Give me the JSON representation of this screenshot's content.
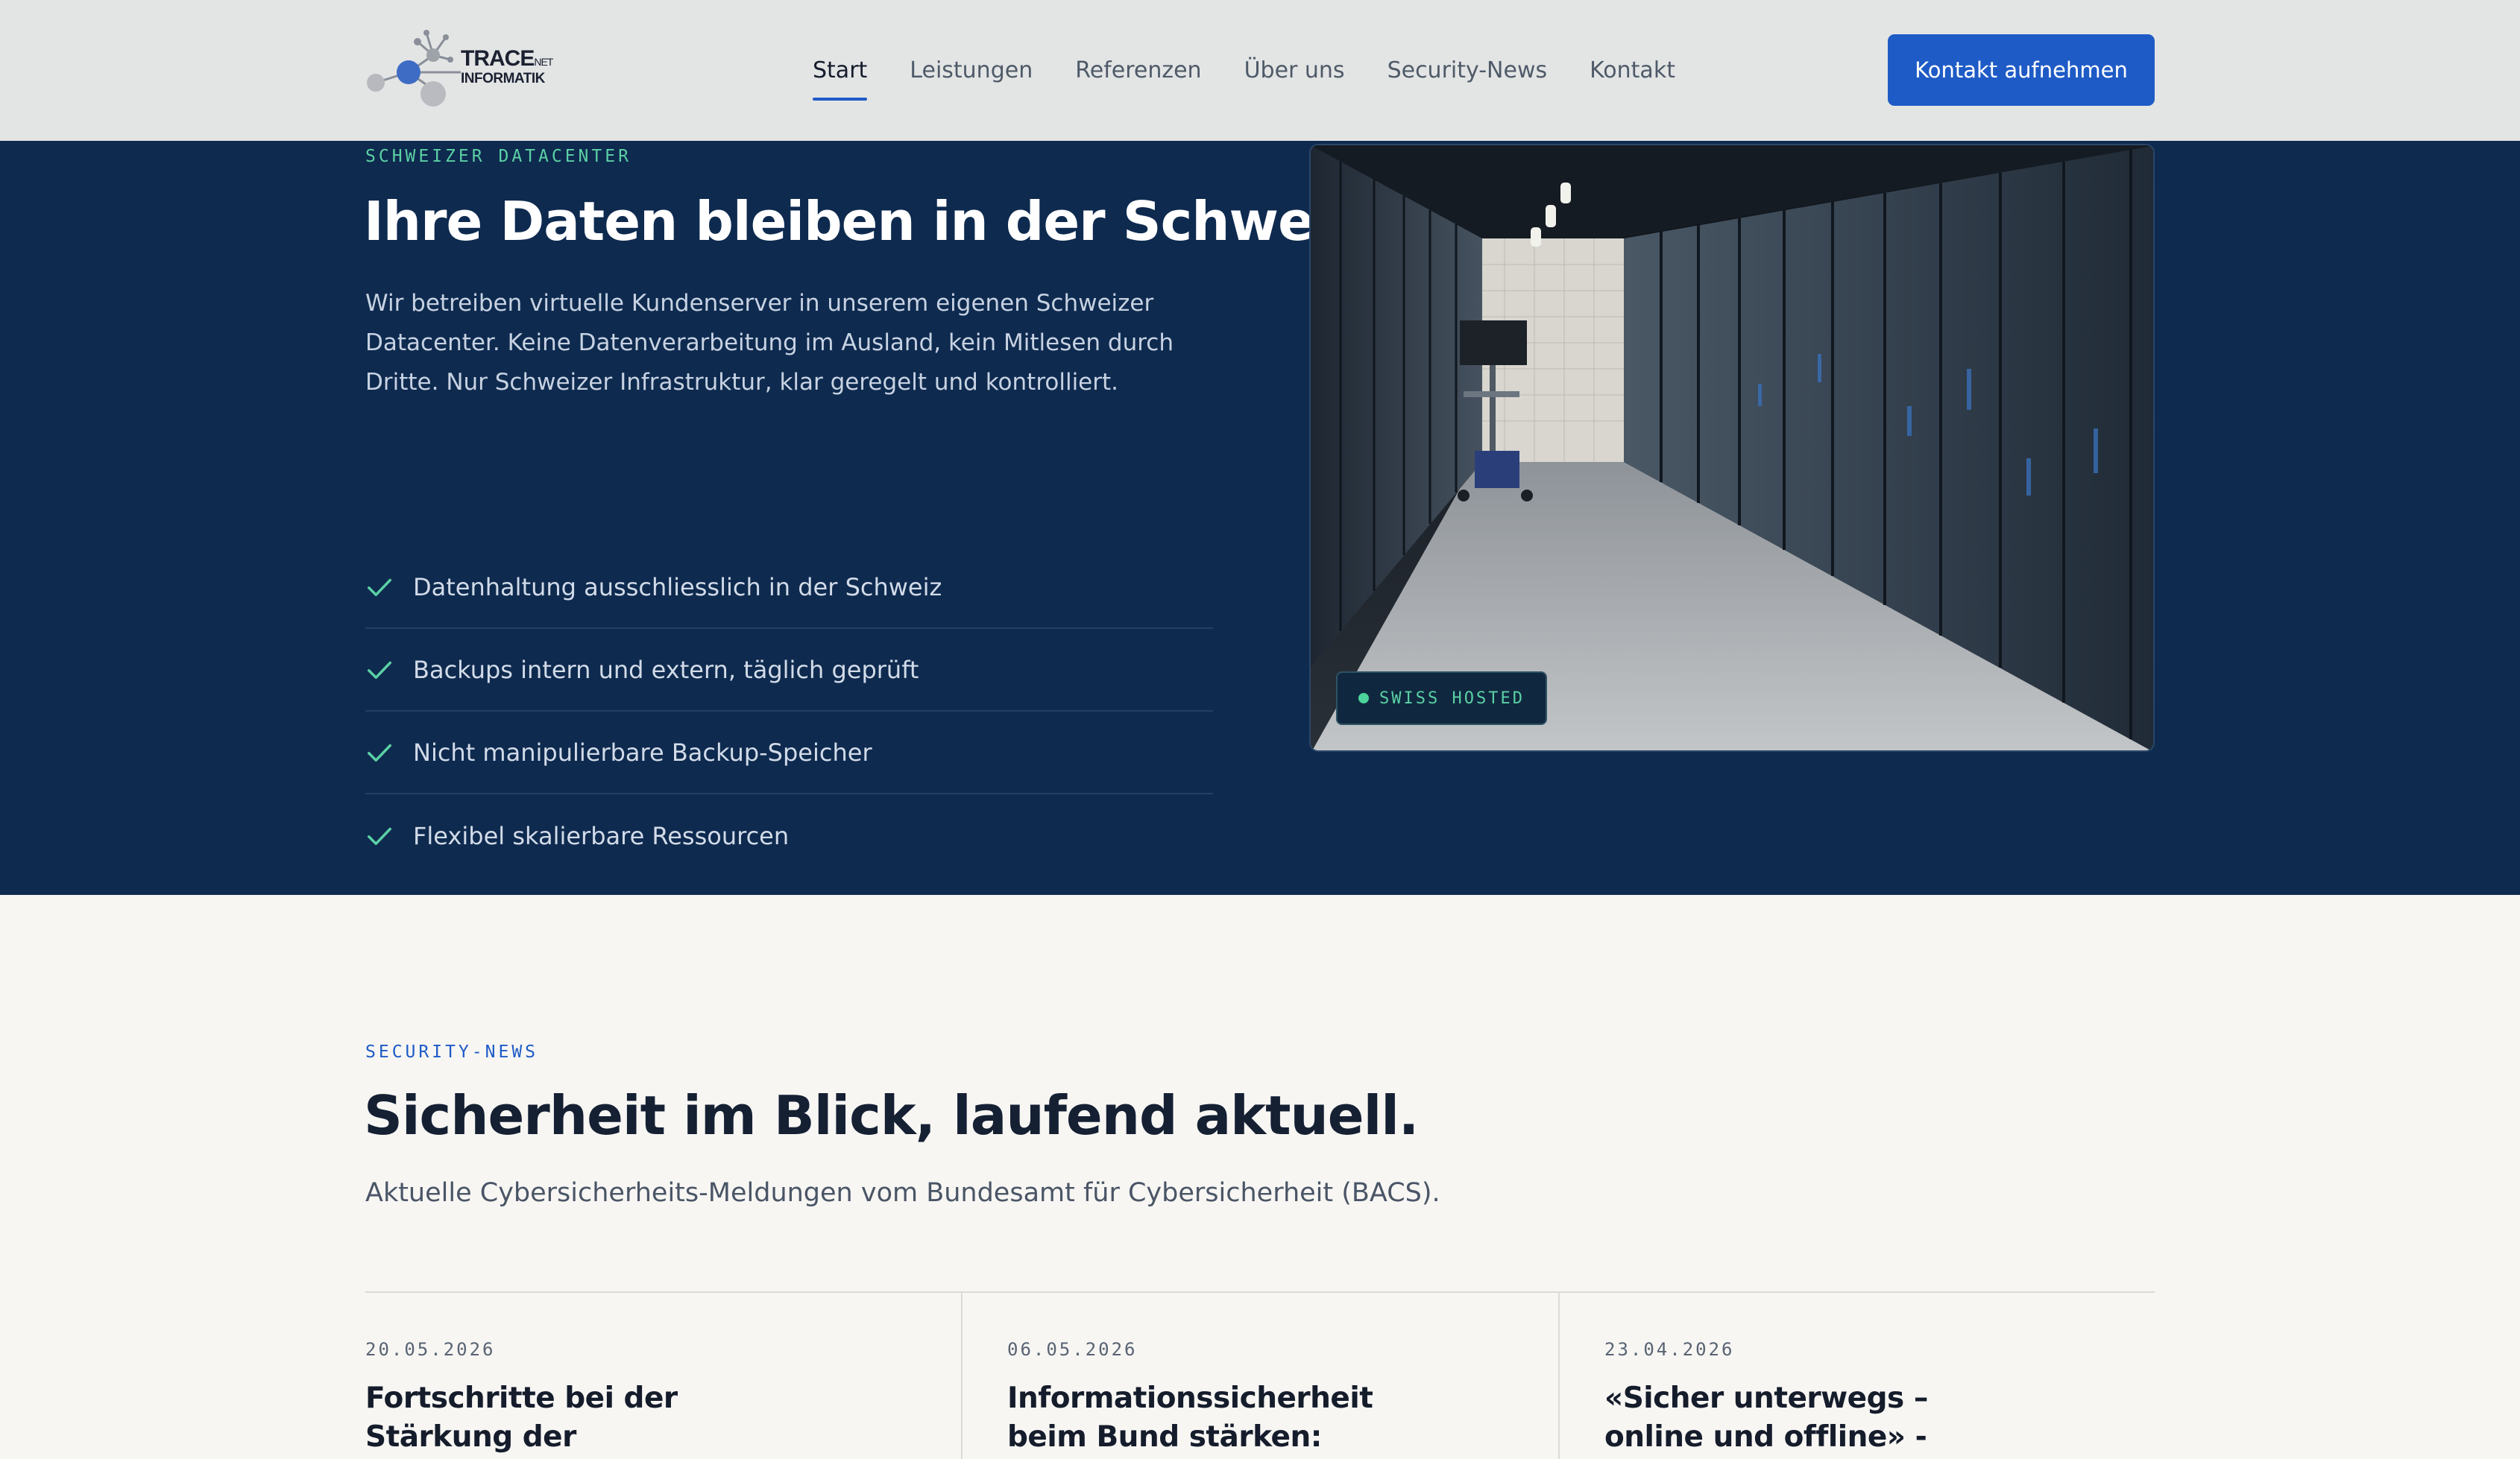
{
  "header": {
    "logo": {
      "line1": "TRACE",
      "line1_suffix": "NET",
      "line2": "INFORMATIK"
    },
    "nav": [
      {
        "label": "Start",
        "active": true
      },
      {
        "label": "Leistungen"
      },
      {
        "label": "Referenzen"
      },
      {
        "label": "Über uns"
      },
      {
        "label": "Security-News"
      },
      {
        "label": "Kontakt"
      }
    ],
    "cta_label": "Kontakt aufnehmen"
  },
  "hero": {
    "eyebrow": "SCHWEIZER DATACENTER",
    "title": "Ihre Daten bleiben in der Schweiz.",
    "description": "Wir betreiben virtuelle Kundenserver in unserem eigenen Schweizer Datacenter. Keine Datenverarbeitung im Ausland, kein Mitlesen durch Dritte. Nur Schweizer Infrastruktur, klar geregelt und kontrolliert.",
    "features": [
      "Datenhaltung ausschliesslich in der Schweiz",
      "Backups intern und extern, täglich geprüft",
      "Nicht manipulierbare Backup-Speicher",
      "Flexibel skalierbare Ressourcen"
    ],
    "image_badge": "SWISS HOSTED"
  },
  "news": {
    "eyebrow": "SECURITY-NEWS",
    "title": "Sicherheit im Blick, laufend aktuell.",
    "subtitle": "Aktuelle Cybersicherheits-Meldungen vom Bundesamt für Cybersicherheit (BACS).",
    "articles": [
      {
        "date": "20.05.2026",
        "title": "Fortschritte bei der Stärkung der Cybersicherheit"
      },
      {
        "date": "06.05.2026",
        "title": "Informationssicherheit beim Bund stärken: Bundesrat"
      },
      {
        "date": "23.04.2026",
        "title": "«Sicher unterwegs – online und offline» - Sensibilisierungs-"
      }
    ]
  },
  "colors": {
    "accent": "#1e5bc6",
    "hero_bg": "#0e2a4f",
    "green": "#5bd0a4",
    "header_bg": "#e3e5e5",
    "page_bg": "#f7f6f3"
  }
}
